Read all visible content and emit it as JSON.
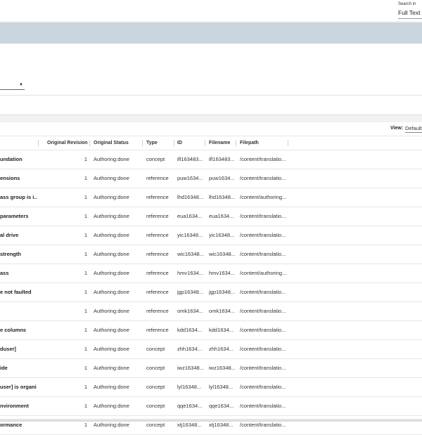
{
  "search": {
    "label": "Search in",
    "value": "Full Text"
  },
  "view": {
    "label": "View:",
    "value": "Default"
  },
  "table": {
    "headers": {
      "revision": "Original Revision",
      "status": "Original Status",
      "type": "Type",
      "id": "ID",
      "filename": "Filename",
      "filepath": "Filepath"
    },
    "rows": [
      {
        "title": "undation",
        "revision": "1",
        "status": "Authoring:done",
        "type": "concept",
        "id": "ifl163483...",
        "filename": "ifl163483...",
        "filepath": "/content/translatio..."
      },
      {
        "title": "ensions",
        "revision": "1",
        "status": "Authoring:done",
        "type": "reference",
        "id": "puw1634...",
        "filename": "puw1634...",
        "filepath": "/content/translatio..."
      },
      {
        "title": "ass group is i...",
        "revision": "1",
        "status": "Authoring:done",
        "type": "reference",
        "id": "lhd16348...",
        "filename": "lhd16348...",
        "filepath": "/content/authoring..."
      },
      {
        "title": "parameters",
        "revision": "1",
        "status": "Authoring:done",
        "type": "reference",
        "id": "eua1634...",
        "filename": "eua1634...",
        "filepath": "/content/translatio..."
      },
      {
        "title": "al drive",
        "revision": "1",
        "status": "Authoring:done",
        "type": "reference",
        "id": "yic16348...",
        "filename": "yic16348...",
        "filepath": "/content/translatio..."
      },
      {
        "title": "strength",
        "revision": "1",
        "status": "Authoring:done",
        "type": "reference",
        "id": "wic16348...",
        "filename": "wic16348...",
        "filepath": "/content/translatio..."
      },
      {
        "title": "ass",
        "revision": "1",
        "status": "Authoring:done",
        "type": "reference",
        "id": "hmv1634...",
        "filename": "hmv1634...",
        "filepath": "/content/authoring..."
      },
      {
        "title": "e not faulted",
        "revision": "1",
        "status": "Authoring:done",
        "type": "reference",
        "id": "jgp16348...",
        "filename": "jgp16348...",
        "filepath": "/content/translatio..."
      },
      {
        "title": "",
        "revision": "1",
        "status": "Authoring:done",
        "type": "reference",
        "id": "omk1634...",
        "filename": "omk1634...",
        "filepath": "/content/translatio..."
      },
      {
        "title": "e columns",
        "revision": "1",
        "status": "Authoring:done",
        "type": "reference",
        "id": "kdd1634...",
        "filename": "kdd1634...",
        "filepath": "/content/translatio..."
      },
      {
        "title": "duser]",
        "revision": "1",
        "status": "Authoring:done",
        "type": "concept",
        "id": "zhh1634...",
        "filename": "zhh1634...",
        "filepath": "/content/translatio..."
      },
      {
        "title": "ide",
        "revision": "1",
        "status": "Authoring:done",
        "type": "concept",
        "id": "iwz16348...",
        "filename": "iwz16348...",
        "filepath": "/content/translatio..."
      },
      {
        "title": "user] is organi...",
        "revision": "1",
        "status": "Authoring:done",
        "type": "concept",
        "id": "lyl16348...",
        "filename": "lyl16348...",
        "filepath": "/content/translatio..."
      },
      {
        "title": "nvironment",
        "revision": "1",
        "status": "Authoring:done",
        "type": "concept",
        "id": "qqe1634...",
        "filename": "qqe1634...",
        "filepath": "/content/translatio..."
      },
      {
        "title": "ormance",
        "revision": "1",
        "status": "Authoring:done",
        "type": "concept",
        "id": "xtj16348...",
        "filename": "xtj16348...",
        "filepath": "/content/translatio..."
      }
    ]
  },
  "colors": {
    "banner": "#cbd5e0",
    "strip": "#f2f2f2",
    "border": "#e6e6e6"
  },
  "icons": {
    "dropdown": "caret-down-icon"
  }
}
